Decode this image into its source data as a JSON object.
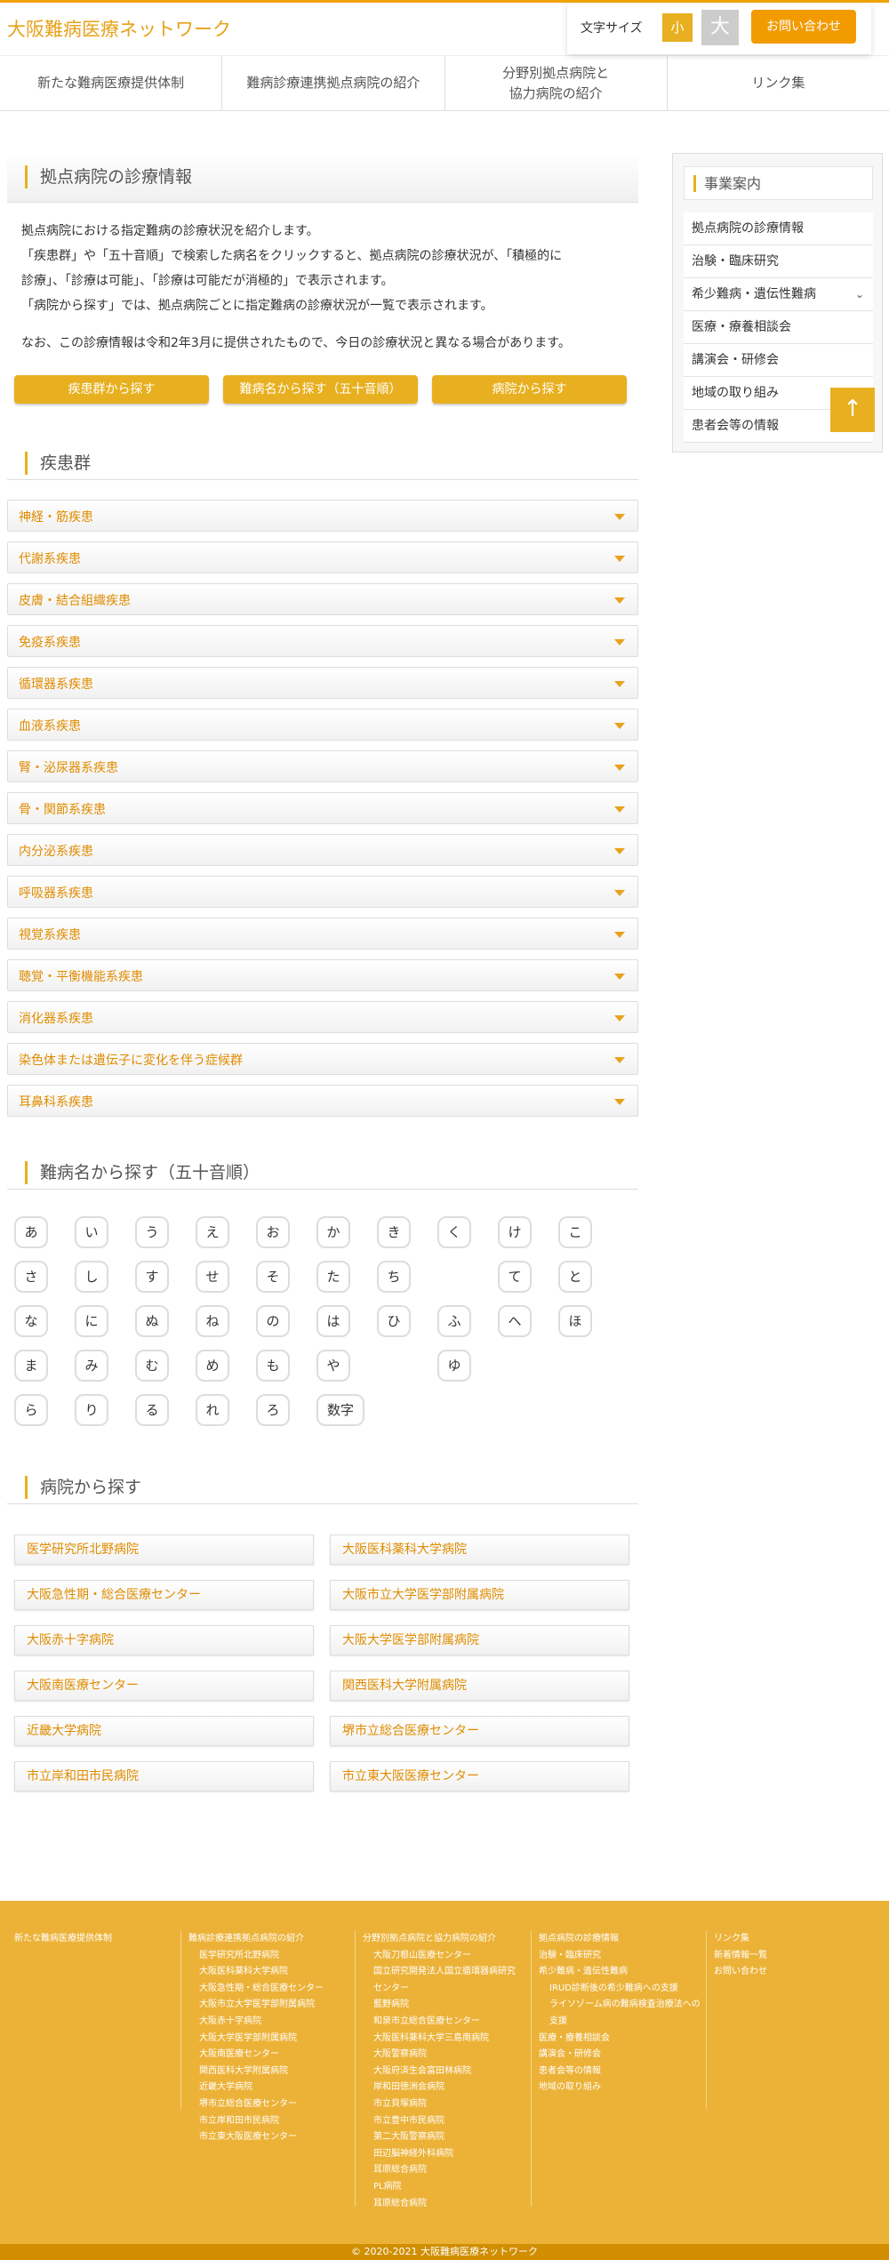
{
  "header": {
    "logo": "大阪難病医療ネットワーク",
    "font_size_label": "文字サイズ",
    "font_small": "小",
    "font_large": "大",
    "contact": "お問い合わせ"
  },
  "nav": [
    {
      "label": "新たな難病医療提供体制"
    },
    {
      "label": "難病診療連携拠点病院の紹介"
    },
    {
      "label": "分野別拠点病院と\n協力病院の紹介"
    },
    {
      "label": "リンク集"
    }
  ],
  "main": {
    "title": "拠点病院の診療情報",
    "intro": [
      "拠点病院における指定難病の診療状況を紹介します。",
      "「疾患群」や「五十音順」で検索した病名をクリックすると、拠点病院の診療状況が、「積極的に",
      "診療」、「診療は可能」、「診療は可能だが消極的」で表示されます。",
      "「病院から探す」では、拠点病院ごとに指定難病の診療状況が一覧で表示されます。"
    ],
    "note": "なお、この診療情報は令和2年3月に提供されたもので、今日の診療状況と異なる場合があります。",
    "buttons": [
      {
        "label": "疾患群から探す"
      },
      {
        "label": "難病名から探す（五十音順）"
      },
      {
        "label": "病院から探す"
      }
    ]
  },
  "disease_section": {
    "title": "疾患群",
    "items": [
      {
        "label": "神経・筋疾患"
      },
      {
        "label": "代謝系疾患"
      },
      {
        "label": "皮膚・結合組織疾患"
      },
      {
        "label": "免疫系疾患"
      },
      {
        "label": "循環器系疾患"
      },
      {
        "label": "血液系疾患"
      },
      {
        "label": "腎・泌尿器系疾患"
      },
      {
        "label": "骨・関節系疾患"
      },
      {
        "label": "内分泌系疾患"
      },
      {
        "label": "呼吸器系疾患"
      },
      {
        "label": "視覚系疾患"
      },
      {
        "label": "聴覚・平衡機能系疾患"
      },
      {
        "label": "消化器系疾患"
      },
      {
        "label": "染色体または遺伝子に変化を伴う症候群"
      },
      {
        "label": "耳鼻科系疾患"
      }
    ]
  },
  "kana_section": {
    "title": "難病名から探す（五十音順）",
    "rows": [
      [
        "あ",
        "い",
        "う",
        "え",
        "お",
        "か",
        "き",
        "く",
        "け",
        "こ"
      ],
      [
        "さ",
        "し",
        "す",
        "せ",
        "そ",
        "た",
        "ち",
        "",
        "て",
        "と"
      ],
      [
        "な",
        "に",
        "ぬ",
        "ね",
        "の",
        "は",
        "ひ",
        "ふ",
        "へ",
        "ほ"
      ],
      [
        "ま",
        "み",
        "む",
        "め",
        "も",
        "や",
        "",
        "ゆ",
        "",
        ""
      ],
      [
        "ら",
        "り",
        "る",
        "れ",
        "ろ",
        "数字",
        "",
        "",
        "",
        ""
      ]
    ]
  },
  "hospital_section": {
    "title": "病院から探す",
    "items": [
      {
        "label": "医学研究所北野病院"
      },
      {
        "label": "大阪医科薬科大学病院"
      },
      {
        "label": "大阪急性期・総合医療センター"
      },
      {
        "label": "大阪市立大学医学部附属病院"
      },
      {
        "label": "大阪赤十字病院"
      },
      {
        "label": "大阪大学医学部附属病院"
      },
      {
        "label": "大阪南医療センター"
      },
      {
        "label": "関西医科大学附属病院"
      },
      {
        "label": "近畿大学病院"
      },
      {
        "label": "堺市立総合医療センター"
      },
      {
        "label": "市立岸和田市民病院"
      },
      {
        "label": "市立東大阪医療センター"
      }
    ]
  },
  "sidebar": {
    "title": "事業案内",
    "items": [
      {
        "label": "拠点病院の診療情報"
      },
      {
        "label": "治験・臨床研究"
      },
      {
        "label": "希少難病・遺伝性難病",
        "chevron": "⌄"
      },
      {
        "label": "医療・療養相談会"
      },
      {
        "label": "講演会・研修会"
      },
      {
        "label": "地域の取り組み"
      },
      {
        "label": "患者会等の情報"
      }
    ],
    "to_top": "↑"
  },
  "footer": {
    "col1": [
      "新たな難病医療提供体制"
    ],
    "col2_head": "難病診療連携拠点病院の紹介",
    "col2": [
      "医学研究所北野病院",
      "大阪医科薬科大学病院",
      "大阪急性期・総合医療センター",
      "大阪市立大学医学部附属病院",
      "大阪赤十字病院",
      "大阪大学医学部附属病院",
      "大阪南医療センター",
      "関西医科大学附属病院",
      "近畿大学病院",
      "堺市立総合医療センター",
      "市立岸和田市民病院",
      "市立東大阪医療センター"
    ],
    "col3_head": "分野別拠点病院と協力病院の紹介",
    "col3": [
      "大阪刀根山医療センター",
      "国立研究開発法人国立循環器病研究",
      "センター",
      "藍野病院",
      "和泉市立総合医療センター",
      "大阪医科薬科大学三島南病院",
      "大阪警察病院",
      "大阪府済生会富田林病院",
      "岸和田徳洲会病院",
      "市立貝塚病院",
      "市立豊中市民病院",
      "第二大阪警察病院",
      "田辺脳神経外科病院",
      "耳原総合病院",
      "PL病院",
      "耳原総合病院"
    ],
    "col4": [
      "拠点病院の診療情報",
      "治験・臨床研究",
      "希少難病・遺伝性難病",
      "IRUD診断後の希少難病への支援",
      "ライソゾーム病の難病検査治療法への",
      "支援",
      "医療・療養相談会",
      "講演会・研修会",
      "患者会等の情報",
      "地域の取り組み"
    ],
    "col5": [
      "リンク集",
      "新着情報一覧",
      "お問い合わせ"
    ],
    "copyright": "© 2020-2021 大阪難病医療ネットワーク"
  }
}
